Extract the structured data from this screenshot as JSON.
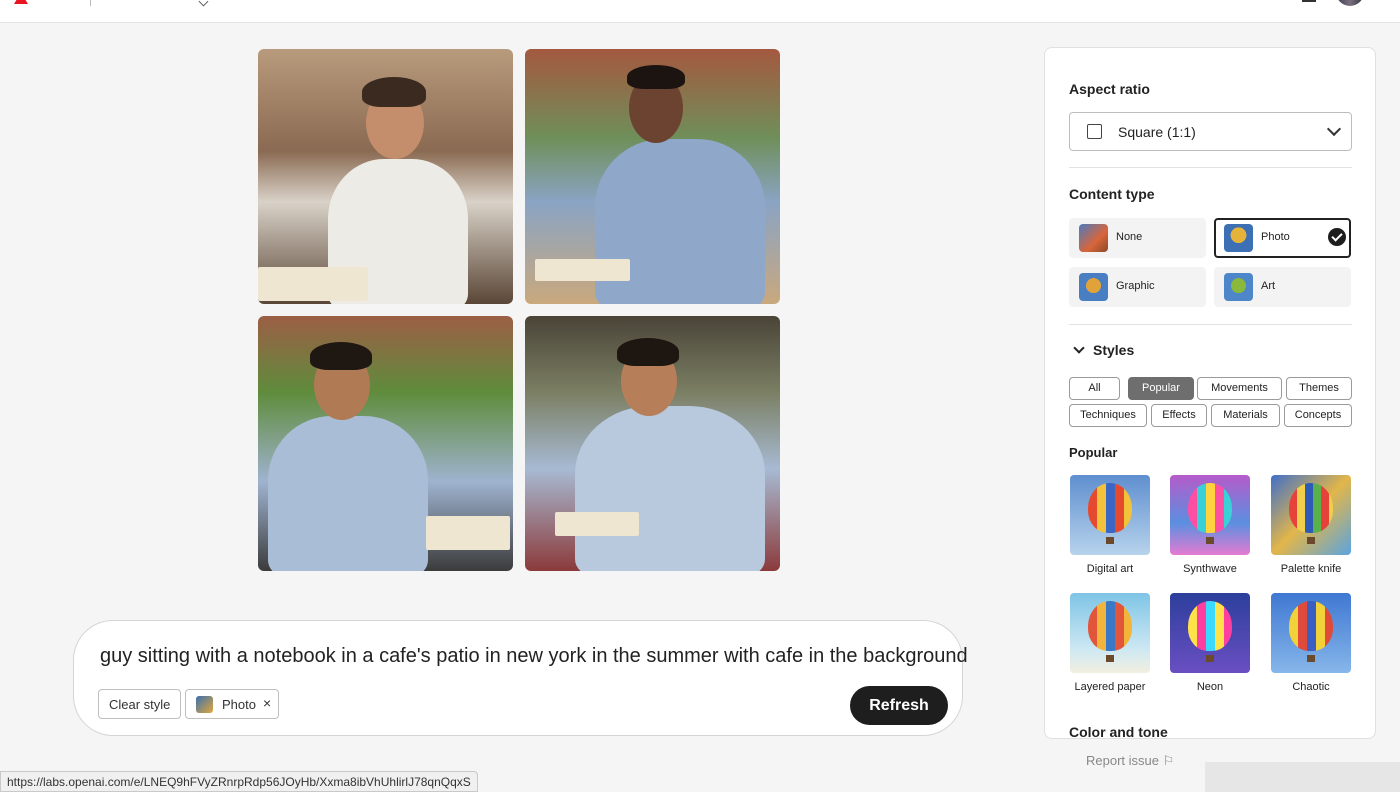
{
  "prompt": {
    "text": "guy sitting with a notebook in a cafe's patio in new york in the summer with cafe in the background",
    "clear_label": "Clear style",
    "chip_label": "Photo",
    "chip_remove": "×",
    "refresh_label": "Refresh"
  },
  "report_label": "Report issue ⚐",
  "status_url": "https://labs.openai.com/e/LNEQ9hFVyZRnrpRdp56JOyHb/Xxma8ibVhUhlirlJ78qnQqxS",
  "panel": {
    "aspect": {
      "title": "Aspect ratio",
      "value": "Square (1:1)"
    },
    "content_type": {
      "title": "Content type",
      "options": [
        {
          "label": "None",
          "selected": false
        },
        {
          "label": "Photo",
          "selected": true
        },
        {
          "label": "Graphic",
          "selected": false
        },
        {
          "label": "Art",
          "selected": false
        }
      ]
    },
    "styles": {
      "title": "Styles",
      "filters": [
        "All",
        "Popular",
        "Movements",
        "Themes",
        "Techniques",
        "Effects",
        "Materials",
        "Concepts"
      ],
      "active_filter": "Popular",
      "section_title": "Popular",
      "items": [
        "Digital art",
        "Synthwave",
        "Palette knife",
        "Layered paper",
        "Neon",
        "Chaotic"
      ]
    },
    "next_section": "Color and tone"
  },
  "colors": {
    "accent": "#1e1e1e",
    "brand": "#e8141f",
    "active_pill": "#6e6e6e"
  }
}
